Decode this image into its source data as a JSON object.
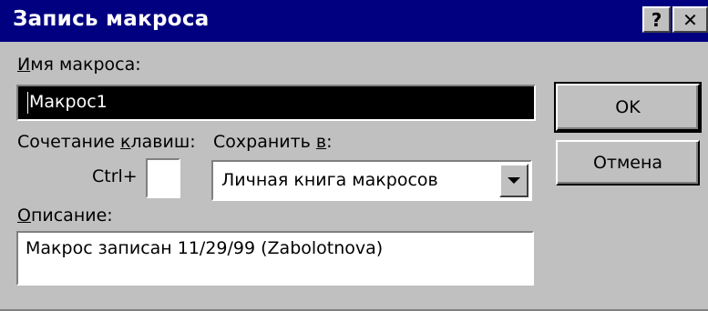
{
  "window": {
    "title": "Запись макроса",
    "help_label": "?",
    "close_label": "✕"
  },
  "macro_name": {
    "label_accel": "И",
    "label_rest": "мя макроса:",
    "value": "Макрос1"
  },
  "shortcut": {
    "label_pre": "Сочетание ",
    "label_accel": "к",
    "label_post": "лавиш:",
    "prefix": "Ctrl+",
    "value": ""
  },
  "store_in": {
    "label_pre": "Сохранить ",
    "label_accel": "в",
    "label_post": ":",
    "selected": "Личная книга макросов"
  },
  "description": {
    "label_accel": "О",
    "label_rest": "писание:",
    "value": "Макрос записан 11/29/99 (Zabolotnova)"
  },
  "buttons": {
    "ok": "OK",
    "cancel": "Отмена"
  },
  "colors": {
    "titlebar": "#000080",
    "face": "#c0c0c0"
  },
  "icons": {
    "dropdown": "chevron-down-icon"
  }
}
